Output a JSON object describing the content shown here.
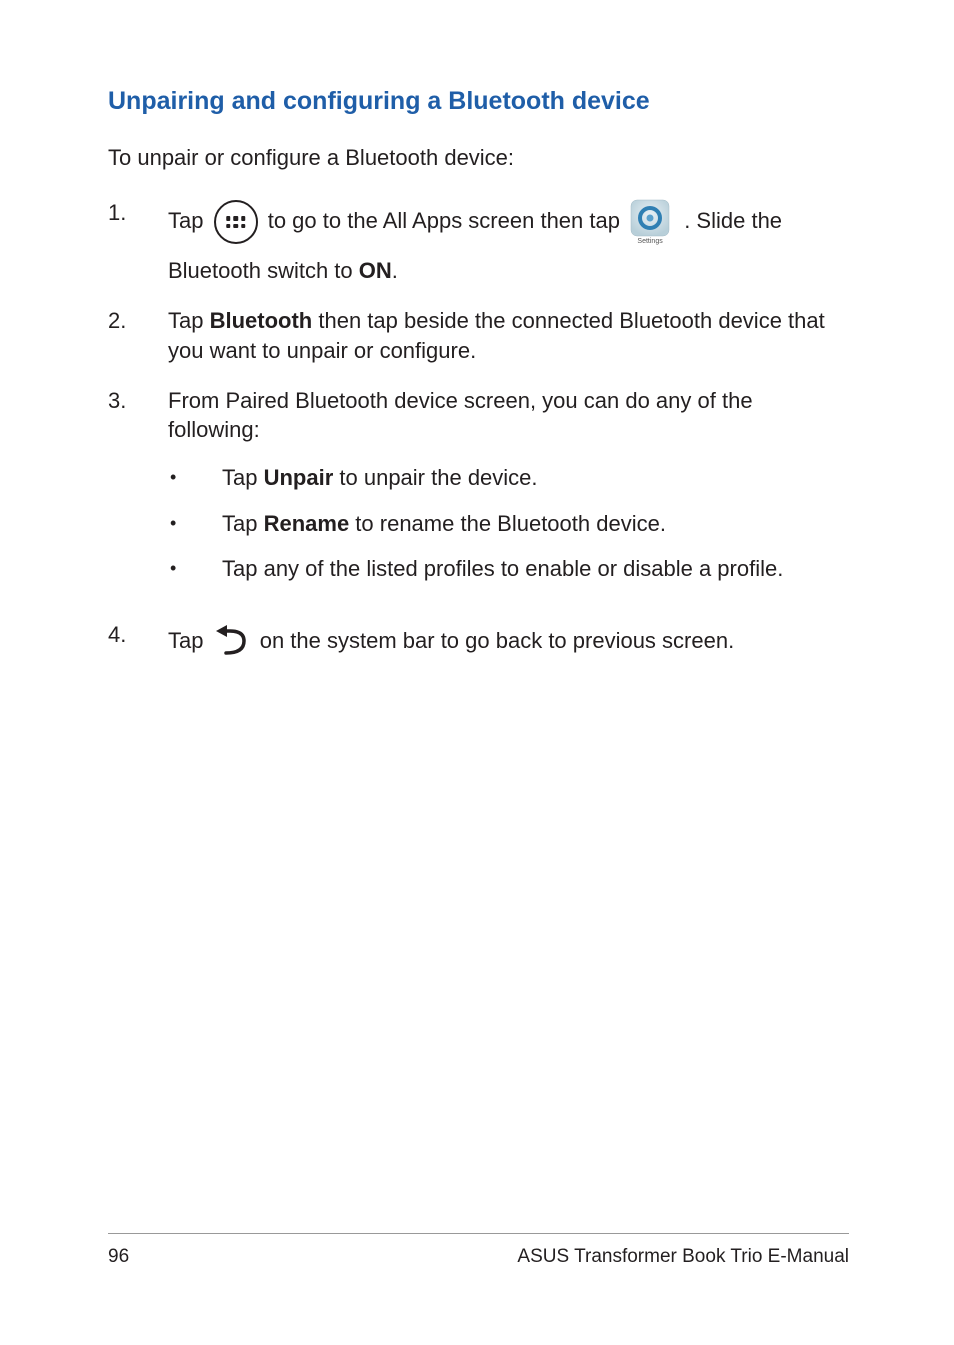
{
  "heading": "Unpairing and configuring a Bluetooth device",
  "intro": "To unpair or configure a Bluetooth device:",
  "steps": {
    "s1": {
      "num": "1.",
      "p1a": "Tap ",
      "p1b": " to go to the All Apps screen then tap ",
      "p1c": " . Slide the",
      "p2a": "Bluetooth switch to ",
      "p2b": "ON",
      "p2c": "."
    },
    "s2": {
      "num": "2.",
      "a": "Tap ",
      "b": "Bluetooth",
      "c": " then tap  beside the connected Bluetooth device that you want to unpair or configure."
    },
    "s3": {
      "num": "3.",
      "lead": "From Paired Bluetooth device screen, you can do any of the following:",
      "bullets": {
        "b1": {
          "dot": "•",
          "a": "Tap ",
          "b": "Unpair",
          "c": " to unpair the device."
        },
        "b2": {
          "dot": "•",
          "a": "Tap ",
          "b": "Rename",
          "c": " to rename the Bluetooth device."
        },
        "b3": {
          "dot": "•",
          "text": "Tap any of the listed profiles to enable or disable a profile."
        }
      }
    },
    "s4": {
      "num": "4.",
      "a": "Tap ",
      "b": " on the system bar to go back to previous screen."
    }
  },
  "settings_label": "Settings",
  "footer": {
    "page": "96",
    "title": "ASUS Transformer Book Trio E-Manual"
  }
}
